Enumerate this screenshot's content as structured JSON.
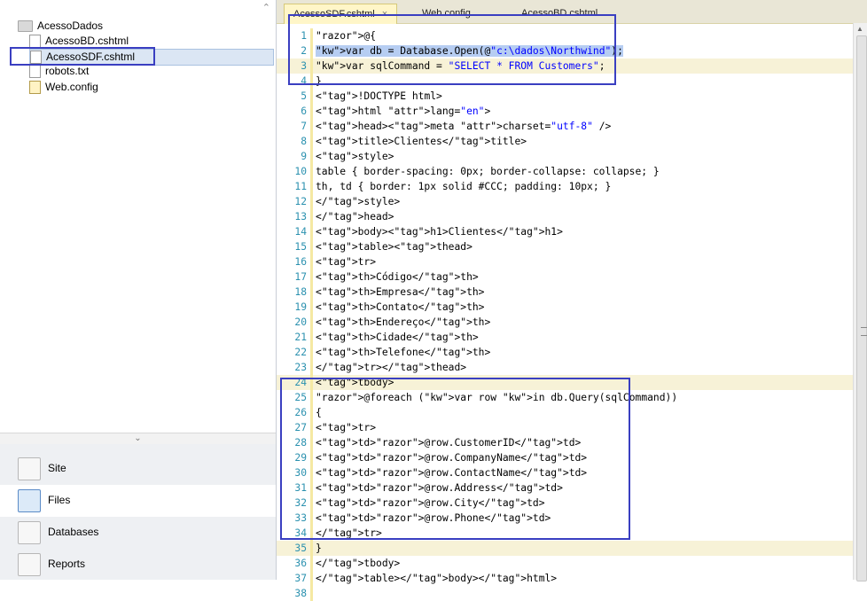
{
  "explorer": {
    "root_label": "AcessoDados",
    "files": [
      {
        "label": "AcessoBD.cshtml",
        "icon": "file-icon"
      },
      {
        "label": "AcessoSDF.cshtml",
        "icon": "file-icon",
        "selected": true
      },
      {
        "label": "robots.txt",
        "icon": "file-icon"
      },
      {
        "label": "Web.config",
        "icon": "config-file-icon"
      }
    ]
  },
  "workspace_nav": [
    {
      "label": "Site",
      "icon": "site-icon"
    },
    {
      "label": "Files",
      "icon": "files-icon",
      "active": true
    },
    {
      "label": "Databases",
      "icon": "databases-icon"
    },
    {
      "label": "Reports",
      "icon": "reports-icon"
    }
  ],
  "tabs": [
    {
      "label": "AcessoSDF.cshtml",
      "active": true
    },
    {
      "label": "Web.config"
    },
    {
      "label": "AcessoBD.cshtml"
    }
  ],
  "code": {
    "line_numbers": [
      "1",
      "2",
      "3",
      "4",
      "5",
      "6",
      "7",
      "8",
      "9",
      "10",
      "11",
      "12",
      "13",
      "14",
      "15",
      "16",
      "17",
      "18",
      "19",
      "20",
      "21",
      "22",
      "23",
      "24",
      "25",
      "26",
      "27",
      "28",
      "29",
      "30",
      "31",
      "32",
      "33",
      "34",
      "35",
      "36",
      "37",
      "38"
    ],
    "lines": [
      "@{",
      "var db = Database.Open(@\"c:\\dados\\Northwind\");",
      "var sqlCommand = \"SELECT * FROM Customers\";",
      "}",
      "<!DOCTYPE html>",
      "<html lang=\"en\">",
      "<head><meta charset=\"utf-8\" />",
      "<title>Clientes</title>",
      "<style>",
      "table { border-spacing: 0px; border-collapse: collapse; }",
      "th, td { border: 1px solid #CCC; padding: 10px; }",
      "</style>",
      "</head>",
      "<body><h1>Clientes</h1>",
      "<table><thead>",
      "<tr>",
      "<th>Código</th>",
      "<th>Empresa</th>",
      "<th>Contato</th>",
      "<th>Endereço</th>",
      "<th>Cidade</th>",
      "<th>Telefone</th>",
      "</tr></thead>",
      "<tbody>",
      "@foreach (var row in db.Query(sqlCommand))",
      "{",
      "<tr>",
      "<td>@row.CustomerID</td>",
      "<td>@row.CompanyName</td>",
      "<td>@row.ContactName</td>",
      "<td>@row.Address</td>",
      "<td>@row.City</td>",
      "<td>@row.Phone</td>",
      "</tr>",
      "}",
      "</tbody>",
      "</table></body></html>",
      ""
    ]
  },
  "colors": {
    "annotation_box": "#3a3fc1",
    "selection": "#b6cdf2",
    "razor_highlight": "#ffff00",
    "line_number": "#2b91af"
  }
}
